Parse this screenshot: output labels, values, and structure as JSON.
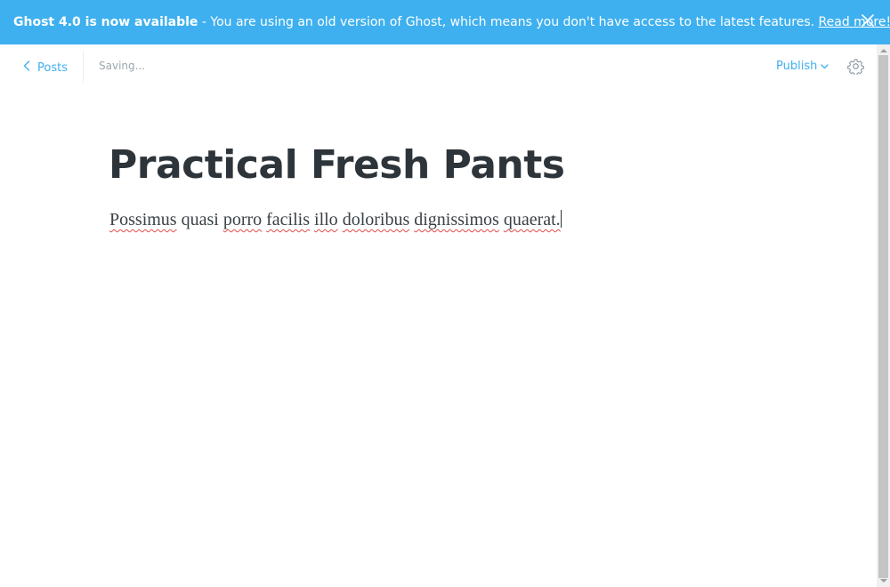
{
  "banner": {
    "headline": "Ghost 4.0 is now available",
    "message": " - You are using an old version of Ghost, which means you don't have access to the latest features. ",
    "link_label": "Read more!",
    "close_icon": "close-icon"
  },
  "toolbar": {
    "back_label": "Posts",
    "back_icon": "chevron-left-icon",
    "status": "Saving...",
    "publish_label": "Publish",
    "publish_icon": "chevron-down-icon",
    "settings_icon": "gear-icon"
  },
  "editor": {
    "title": "Practical Fresh Pants",
    "words": [
      "Possimus",
      "quasi",
      "porro",
      "facilis",
      "illo",
      "doloribus",
      "dignissimos",
      "quaerat."
    ]
  },
  "colors": {
    "accent": "#3eb0ef",
    "title_text": "#2d343a",
    "muted": "#9aa6ad",
    "spellcheck": "#e04c4c"
  }
}
